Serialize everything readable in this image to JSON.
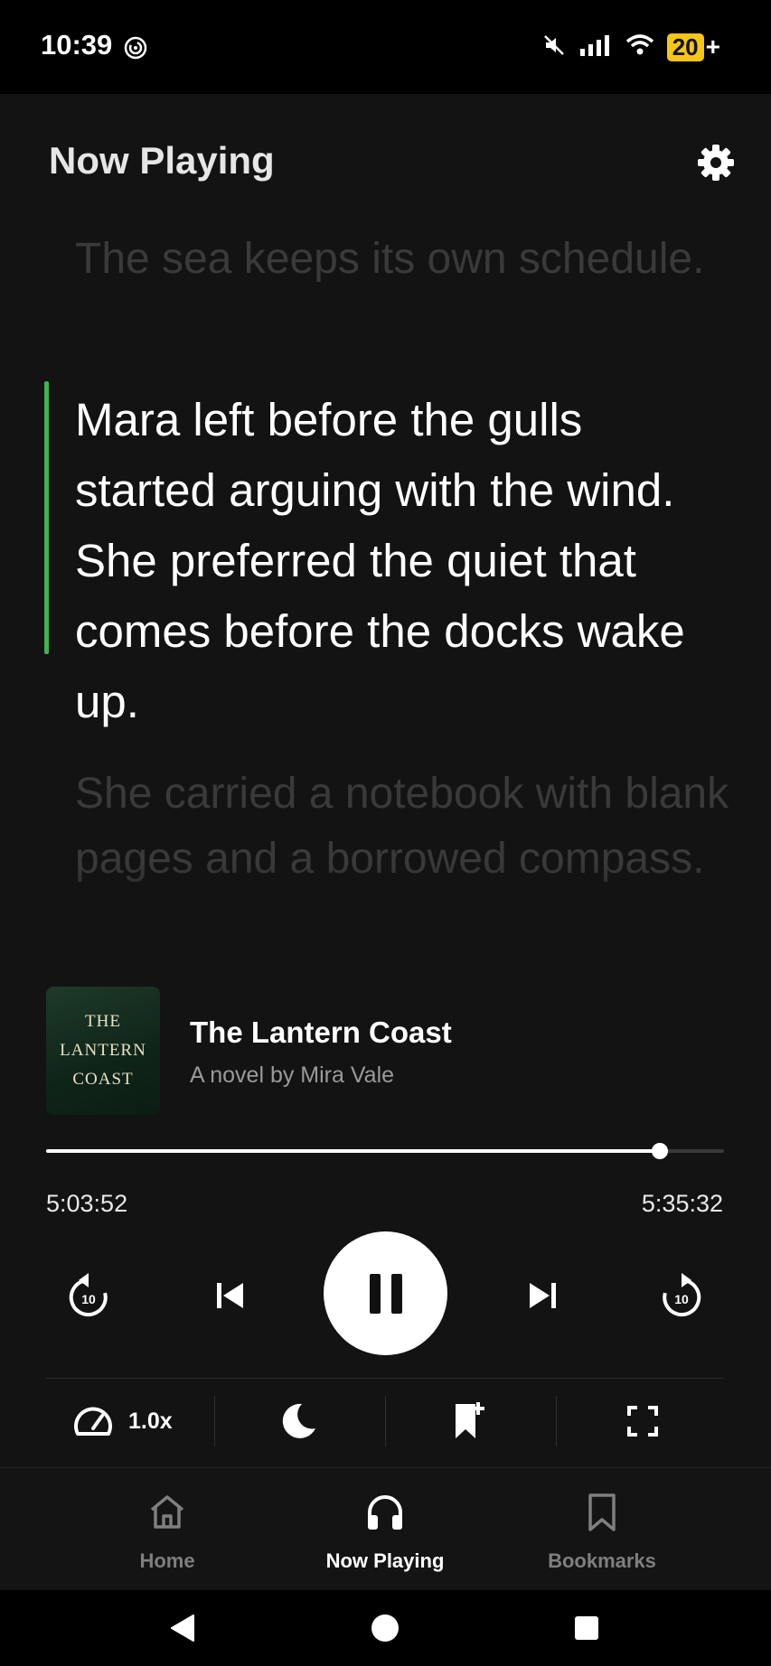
{
  "status_bar": {
    "time": "10:39",
    "battery": "20",
    "battery_suffix": "+"
  },
  "header": {
    "title": "Now Playing"
  },
  "transcript": {
    "previous": "The sea keeps its own schedule.",
    "current": "Mara left before the gulls started arguing with the wind. She preferred the quiet that comes before the docks wake up.",
    "next": "She carried a notebook with blank pages and a borrowed compass."
  },
  "book": {
    "cover_text_line1": "THE",
    "cover_text_line2": "LANTERN",
    "cover_text_line3": "COAST",
    "title": "The Lantern Coast",
    "author": "A novel by Mira Vale"
  },
  "playback": {
    "elapsed": "5:03:52",
    "total": "5:35:32",
    "progress_fraction": 0.905,
    "skip_seconds": "10"
  },
  "tools": {
    "speed": "1.0x"
  },
  "bottom_nav": {
    "items": [
      {
        "label": "Home",
        "icon": "home-icon"
      },
      {
        "label": "Now Playing",
        "icon": "headphones-icon",
        "active": true
      },
      {
        "label": "Bookmarks",
        "icon": "bookmark-icon"
      }
    ]
  },
  "colors": {
    "accent": "#3fb44f",
    "background": "#131313",
    "battery": "#f5c518"
  }
}
